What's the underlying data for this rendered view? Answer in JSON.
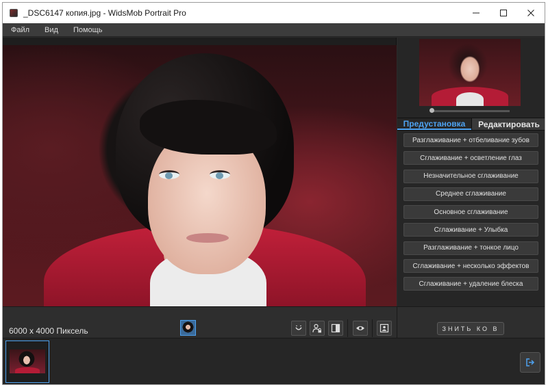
{
  "window": {
    "title": "_DSC6147 копия.jpg - WidsMob Portrait Pro",
    "controls": {
      "minimize": "minimize-icon",
      "maximize": "maximize-icon",
      "close": "close-icon"
    }
  },
  "menu": {
    "items": [
      {
        "label": "Файл"
      },
      {
        "label": "Вид"
      },
      {
        "label": "Помощь"
      }
    ]
  },
  "right_panel": {
    "tabs": [
      {
        "label": "Предустановка",
        "active": true
      },
      {
        "label": "Редактировать",
        "active": false
      }
    ],
    "presets": [
      {
        "label": "Разглаживание + отбеливание зубов"
      },
      {
        "label": "Сглаживание + осветление глаз"
      },
      {
        "label": "Незначительное сглаживание"
      },
      {
        "label": "Среднее сглаживание"
      },
      {
        "label": "Основное сглаживание"
      },
      {
        "label": "Сглаживание + Улыбка"
      },
      {
        "label": "Разглаживание + тонкое лицо"
      },
      {
        "label": "Сглаживание + несколько эффектов"
      },
      {
        "label": "Сглаживание + удаление блеска"
      }
    ]
  },
  "toolbar": {
    "dimensions": "6000 x 4000 Пиксель",
    "apply_label": "ЗНИТЬ КО В",
    "tools": {
      "smile": "smile-icon",
      "lock_person": "person-lock-icon",
      "compare": "split-compare-icon",
      "preview": "eye-icon",
      "portrait": "portrait-frame-icon"
    }
  },
  "filmstrip": {
    "export": "export-icon"
  },
  "colors": {
    "accent": "#4ea2f0",
    "panel_bg": "#262626",
    "button_bg": "#3a3a3a"
  }
}
